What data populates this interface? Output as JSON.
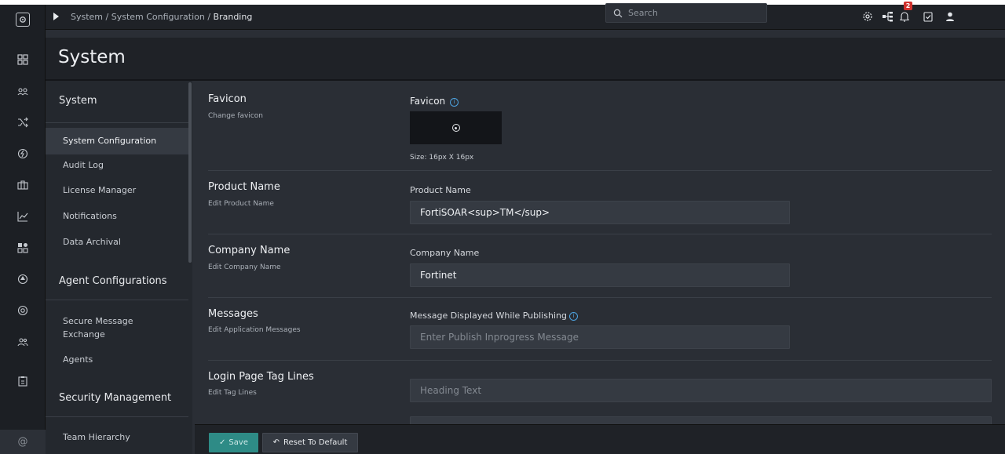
{
  "window": {
    "app_name_partial": ""
  },
  "breadcrumb": {
    "path": "System / System Configuration / ",
    "current": "Branding"
  },
  "search": {
    "placeholder": "Search"
  },
  "notifications": {
    "count": "2"
  },
  "page": {
    "title": "System"
  },
  "subnav": {
    "groups": [
      {
        "label": "System"
      },
      {
        "label": "Agent Configurations"
      },
      {
        "label": "Security Management"
      }
    ],
    "items": [
      {
        "label": "System Configuration",
        "active": true
      },
      {
        "label": "Audit Log"
      },
      {
        "label": "License Manager"
      },
      {
        "label": "Notifications"
      },
      {
        "label": "Data Archival"
      },
      {
        "label": "Secure Message Exchange"
      },
      {
        "label": "Agents"
      },
      {
        "label": "Team Hierarchy"
      }
    ]
  },
  "sections": {
    "favicon": {
      "title": "Favicon",
      "subtitle": "Change favicon",
      "label": "Favicon",
      "size_note": "Size: 16px X 16px"
    },
    "product": {
      "title": "Product Name",
      "subtitle": "Edit Product Name",
      "label": "Product Name",
      "value": "FortiSOAR<sup>TM</sup>"
    },
    "company": {
      "title": "Company Name",
      "subtitle": "Edit Company Name",
      "label": "Company Name",
      "value": "Fortinet"
    },
    "messages": {
      "title": "Messages",
      "subtitle": "Edit Application Messages",
      "label": "Message Displayed While Publishing",
      "placeholder": "Enter Publish Inprogress Message"
    },
    "tagline": {
      "title": "Login Page Tag Lines",
      "subtitle": "Edit Tag Lines",
      "heading_placeholder": "Heading Text"
    }
  },
  "footer": {
    "save_label": "Save",
    "reset_label": "Reset To Default"
  },
  "colors": {
    "accent": "#2e8b86",
    "status_ok": "#6bd14a",
    "badge": "#d0312d",
    "info": "#4da3e0"
  }
}
